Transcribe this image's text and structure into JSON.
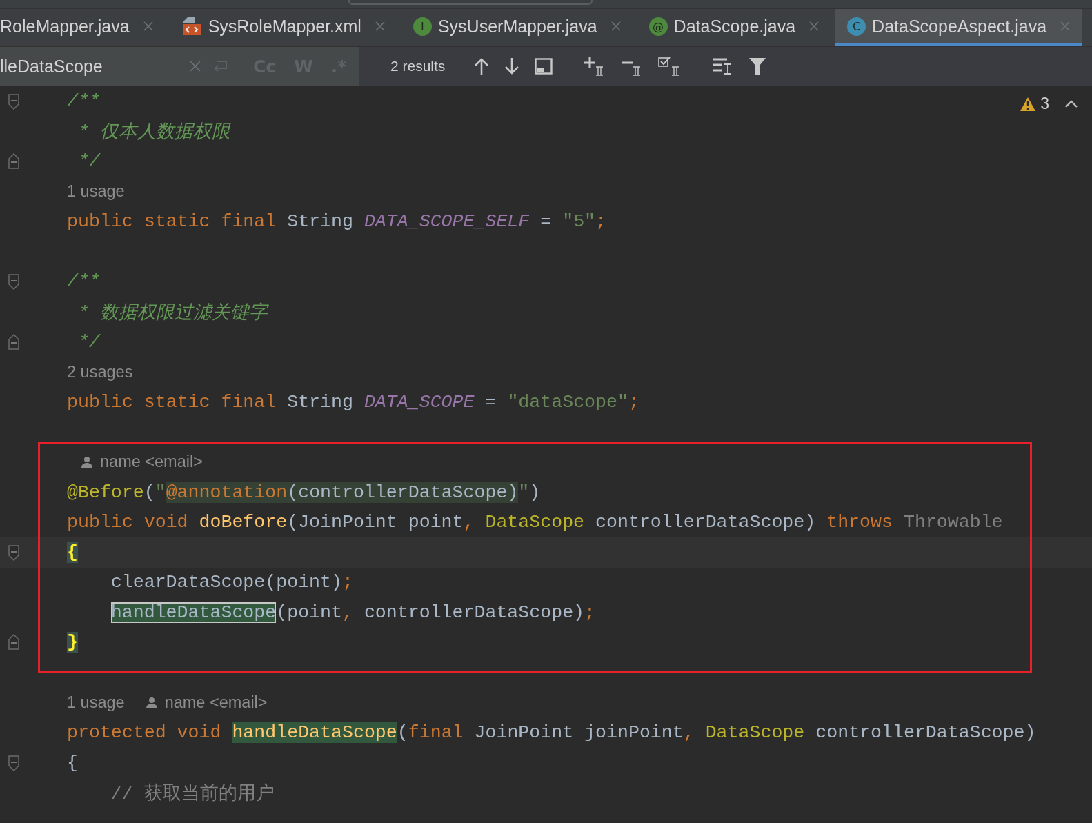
{
  "tabs": [
    {
      "label": "RoleMapper.java",
      "kind": "plain",
      "selected": false
    },
    {
      "label": "SysRoleMapper.xml",
      "kind": "xml",
      "selected": false
    },
    {
      "label": "SysUserMapper.java",
      "kind": "interface",
      "letter": "I",
      "selected": false
    },
    {
      "label": "DataScope.java",
      "kind": "annotation",
      "letter": "@",
      "selected": false
    },
    {
      "label": "DataScopeAspect.java",
      "kind": "class",
      "letter": "C",
      "selected": true
    }
  ],
  "search": {
    "value": "lleDataScope",
    "options": [
      "Cc",
      "W",
      ".*"
    ],
    "results": "2 results"
  },
  "inspections": {
    "warnings": "3"
  },
  "sections": [
    {
      "framed": false,
      "lines": [
        {
          "kind": "code",
          "current": false,
          "indented": false,
          "fold": {
            "kind": "start"
          },
          "tokens": [
            {
              "text": "/**",
              "kind": "doc"
            }
          ]
        },
        {
          "kind": "code",
          "current": false,
          "indented": false,
          "tokens": [
            {
              "text": " * 仅本人数据权限",
              "kind": "doc"
            }
          ]
        },
        {
          "kind": "code",
          "current": false,
          "indented": false,
          "fold": {
            "kind": "end"
          },
          "tokens": [
            {
              "text": " */",
              "kind": "doc"
            }
          ]
        },
        {
          "kind": "hint",
          "current": false,
          "items": [
            {
              "kind": "usage",
              "text": "1 usage"
            }
          ]
        },
        {
          "kind": "code",
          "current": false,
          "indented": false,
          "tokens": [
            {
              "text": "public static final",
              "kind": "keyword"
            },
            {
              "text": " String ",
              "kind": "plain"
            },
            {
              "text": "DATA_SCOPE_SELF",
              "kind": "constant"
            },
            {
              "text": " = ",
              "kind": "plain"
            },
            {
              "text": "\"5\"",
              "kind": "string"
            },
            {
              "text": ";",
              "kind": "punct"
            }
          ]
        },
        {
          "kind": "blank",
          "current": false
        },
        {
          "kind": "code",
          "current": false,
          "indented": false,
          "fold": {
            "kind": "start"
          },
          "tokens": [
            {
              "text": "/**",
              "kind": "doc"
            }
          ]
        },
        {
          "kind": "code",
          "current": false,
          "indented": false,
          "tokens": [
            {
              "text": " * 数据权限过滤关键字",
              "kind": "doc"
            }
          ]
        },
        {
          "kind": "code",
          "current": false,
          "indented": false,
          "fold": {
            "kind": "end"
          },
          "tokens": [
            {
              "text": " */",
              "kind": "doc"
            }
          ]
        },
        {
          "kind": "hint",
          "current": false,
          "items": [
            {
              "kind": "usage",
              "text": "2 usages"
            }
          ]
        },
        {
          "kind": "code",
          "current": false,
          "indented": false,
          "tokens": [
            {
              "text": "public static final",
              "kind": "keyword"
            },
            {
              "text": " String ",
              "kind": "plain"
            },
            {
              "text": "DATA_SCOPE",
              "kind": "constant"
            },
            {
              "text": " = ",
              "kind": "plain"
            },
            {
              "text": "\"dataScope\"",
              "kind": "string"
            },
            {
              "text": ";",
              "kind": "punct"
            }
          ]
        },
        {
          "kind": "blank",
          "current": false
        }
      ]
    },
    {
      "framed": true,
      "lines": [
        {
          "kind": "hint",
          "current": false,
          "items": [
            {
              "kind": "author",
              "text": "name <email>"
            }
          ]
        },
        {
          "kind": "code",
          "current": false,
          "indented": false,
          "tokens": [
            {
              "text": "@Before",
              "kind": "annotation"
            },
            {
              "text": "(",
              "kind": "plain"
            },
            {
              "text": "\"",
              "kind": "string"
            },
            {
              "text": "@annotation",
              "kind": "injected-keyword"
            },
            {
              "text": "(controllerDataScope)",
              "kind": "injected-plain"
            },
            {
              "text": "\"",
              "kind": "string"
            },
            {
              "text": ")",
              "kind": "plain"
            }
          ]
        },
        {
          "kind": "code",
          "current": false,
          "indented": false,
          "tokens": [
            {
              "text": "public void ",
              "kind": "keyword"
            },
            {
              "text": "doBefore",
              "kind": "method"
            },
            {
              "text": "(JoinPoint point",
              "kind": "plain"
            },
            {
              "text": ", ",
              "kind": "punct"
            },
            {
              "text": "DataScope",
              "kind": "annotation"
            },
            {
              "text": " controllerDataScope) ",
              "kind": "plain"
            },
            {
              "text": "throws",
              "kind": "keyword"
            },
            {
              "text": " Throwable",
              "kind": "dim"
            }
          ]
        },
        {
          "kind": "code",
          "current": true,
          "indented": false,
          "fold": {
            "kind": "start"
          },
          "tokens": [
            {
              "text": "{",
              "kind": "matched-brace"
            }
          ]
        },
        {
          "kind": "code",
          "current": false,
          "indented": true,
          "tokens": [
            {
              "text": "clearDataScope(point)",
              "kind": "plain"
            },
            {
              "text": ";",
              "kind": "punct"
            }
          ]
        },
        {
          "kind": "code",
          "current": false,
          "indented": true,
          "tokens": [
            {
              "text": "handleDataScope",
              "kind": "current-match"
            },
            {
              "text": "(point",
              "kind": "plain"
            },
            {
              "text": ", ",
              "kind": "punct"
            },
            {
              "text": "controllerDataScope)",
              "kind": "plain"
            },
            {
              "text": ";",
              "kind": "punct"
            }
          ]
        },
        {
          "kind": "code",
          "current": false,
          "indented": false,
          "fold": {
            "kind": "end"
          },
          "tokens": [
            {
              "text": "}",
              "kind": "matched-brace"
            }
          ]
        }
      ]
    },
    {
      "framed": false,
      "lines": [
        {
          "kind": "blank",
          "current": false
        },
        {
          "kind": "hint",
          "current": false,
          "items": [
            {
              "kind": "usage",
              "text": "1 usage"
            },
            {
              "kind": "author",
              "text": "name <email>"
            }
          ]
        },
        {
          "kind": "code",
          "current": false,
          "indented": false,
          "tokens": [
            {
              "text": "protected void ",
              "kind": "keyword"
            },
            {
              "text": "handleDataScope",
              "kind": "search-match"
            },
            {
              "text": "(",
              "kind": "plain"
            },
            {
              "text": "final",
              "kind": "keyword"
            },
            {
              "text": " JoinPoint joinPoint",
              "kind": "plain"
            },
            {
              "text": ", ",
              "kind": "punct"
            },
            {
              "text": "DataScope",
              "kind": "annotation"
            },
            {
              "text": " controllerDataScope)",
              "kind": "plain"
            }
          ]
        },
        {
          "kind": "code",
          "current": false,
          "indented": false,
          "fold": {
            "kind": "start"
          },
          "tokens": [
            {
              "text": "{",
              "kind": "plain"
            }
          ]
        },
        {
          "kind": "code",
          "current": false,
          "indented": true,
          "tokens": [
            {
              "text": "// 获取当前的用户",
              "kind": "comment"
            }
          ]
        }
      ]
    }
  ]
}
